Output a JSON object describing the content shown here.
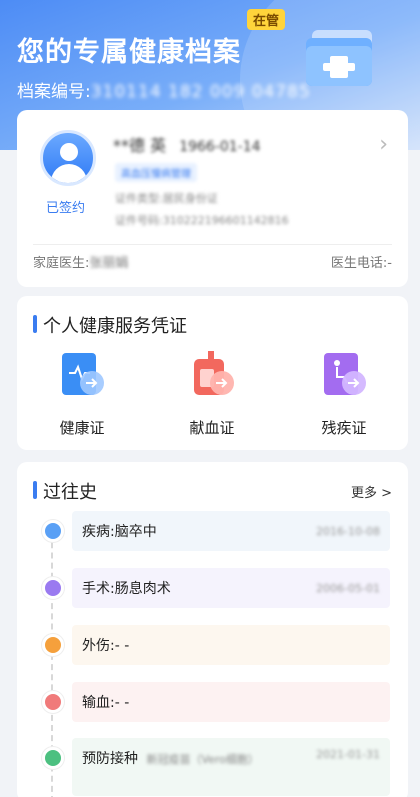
{
  "header": {
    "title": "您的专属健康档案",
    "badge": "在管",
    "file_no_label": "档案编号:",
    "file_no_value": "310114 182 009 04785"
  },
  "profile": {
    "signed_status": "已签约",
    "name": "**德 英",
    "birth_date": "1966-01-14",
    "tag": "高血压慢病管理",
    "id_type": "证件类型:居民身份证",
    "id_number": "证件号码:310222196601142816",
    "doctor_label": "家庭医生:",
    "doctor_value": "张丽娟",
    "phone_label": "医生电话:",
    "phone_value": "-"
  },
  "credentials": {
    "title": "个人健康服务凭证",
    "items": [
      {
        "label": "健康证",
        "icon": "health-card-icon",
        "color": "#3a8ef5"
      },
      {
        "label": "献血证",
        "icon": "blood-donation-icon",
        "color": "#f2685e"
      },
      {
        "label": "残疾证",
        "icon": "disability-card-icon",
        "color": "#a36cf0"
      }
    ]
  },
  "history": {
    "title": "过往史",
    "more_label": "更多 >",
    "items": [
      {
        "text": "疾病:脑卒中",
        "date": "2016-10-08",
        "dot_color": "#5aa0f5",
        "bg": "#f1f6fb"
      },
      {
        "text": "手术:肠息肉术",
        "date": "2006-05-01",
        "dot_color": "#9a7af0",
        "bg": "#f5f3fd"
      },
      {
        "text": "外伤:- -",
        "date": "",
        "dot_color": "#f5a03c",
        "bg": "#fdf7ef"
      },
      {
        "text": "输血:- -",
        "date": "",
        "dot_color": "#f07a7a",
        "bg": "#fdf2f2"
      },
      {
        "text": "预防接种",
        "extra": "新冠疫苗（Vero细胞）",
        "date": "2021-01-31",
        "dot_color": "#4cc080",
        "bg": "#f1f8f4"
      }
    ]
  }
}
